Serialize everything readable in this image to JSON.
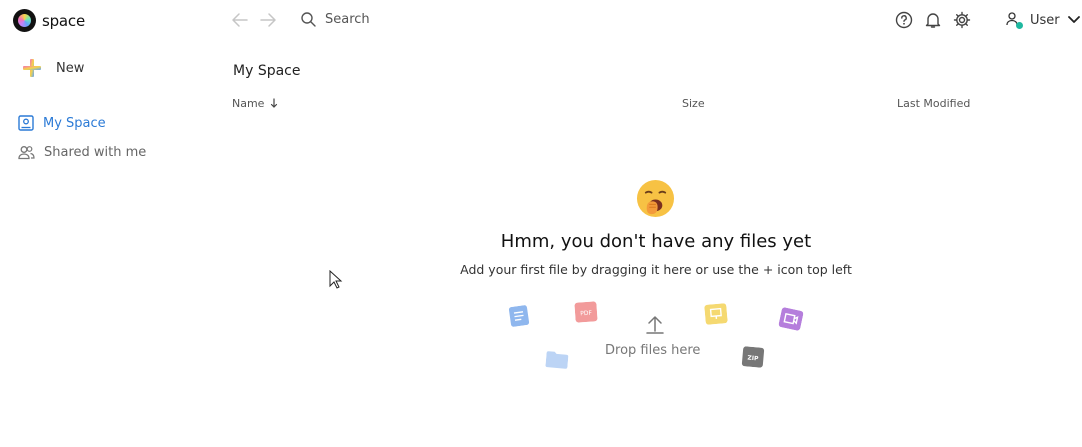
{
  "app": {
    "name": "space"
  },
  "search": {
    "placeholder": "Search"
  },
  "user": {
    "label": "User"
  },
  "sidebar": {
    "new_label": "New",
    "items": [
      {
        "label": "My Space",
        "active": true
      },
      {
        "label": "Shared with me",
        "active": false
      }
    ]
  },
  "main": {
    "title": "My Space",
    "columns": {
      "name": "Name",
      "size": "Size",
      "modified": "Last Modified"
    },
    "empty": {
      "title": "Hmm, you don't have any files yet",
      "subtitle": "Add your first file by dragging it here or use the + icon top left",
      "drop_label": "Drop files here"
    }
  },
  "colors": {
    "accent": "#2b7ad6",
    "status_dot": "#1fb8a0",
    "doc": "#8fb7ee",
    "pdf": "#f29b9b",
    "slides": "#f5d971",
    "video": "#b57edc",
    "folder": "#bcd4f5",
    "zip": "#777777"
  },
  "icons": [
    "space-logo",
    "back-arrow-icon",
    "forward-arrow-icon",
    "search-icon",
    "help-icon",
    "bell-icon",
    "gear-icon",
    "user-icon",
    "chevron-down-icon",
    "plus-icon",
    "my-space-icon",
    "shared-users-icon",
    "sort-down-icon",
    "yawning-emoji",
    "upload-arrow-icon"
  ]
}
